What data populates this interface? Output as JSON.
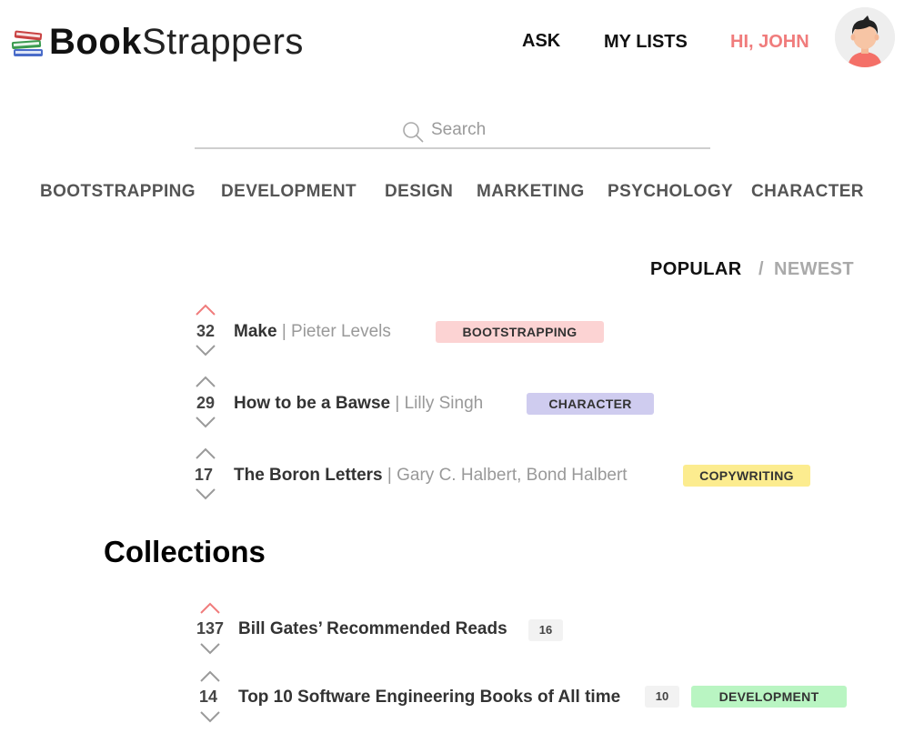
{
  "brand": {
    "name_bold": "Book",
    "name_light": "Strappers"
  },
  "nav": {
    "ask": "ASK",
    "my_lists": "MY LISTS",
    "greeting": "HI, JOHN"
  },
  "search": {
    "placeholder": "Search"
  },
  "categories": [
    "BOOTSTRAPPING",
    "DEVELOPMENT",
    "DESIGN",
    "MARKETING",
    "PSYCHOLOGY",
    "CHARACTER"
  ],
  "sort": {
    "popular": "POPULAR",
    "separator": "/",
    "newest": "NEWEST",
    "active": "popular"
  },
  "books": [
    {
      "votes": "32",
      "title": "Make",
      "author": "| Pieter Levels",
      "tag": "BOOTSTRAPPING",
      "tag_color": "#fcd3d3",
      "upvoted": true
    },
    {
      "votes": "29",
      "title": "How to be a Bawse",
      "author": "| Lilly Singh",
      "tag": "CHARACTER",
      "tag_color": "#cfccef",
      "upvoted": false
    },
    {
      "votes": "17",
      "title": "The Boron Letters",
      "author": "| Gary C. Halbert, Bond Halbert",
      "tag": "COPYWRITING",
      "tag_color": "#fcec8f",
      "upvoted": false
    }
  ],
  "collections_heading": "Collections",
  "collections": [
    {
      "votes": "137",
      "title": "Bill Gates’ Recommended Reads",
      "count": "16",
      "upvoted": true
    },
    {
      "votes": "14",
      "title": "Top 10 Software Engineering Books of All time",
      "count": "10",
      "tag": "DEVELOPMENT",
      "tag_color": "#b9f5c2",
      "upvoted": false
    }
  ],
  "colors": {
    "accent": "#f07c7c",
    "arrow_inactive": "#9a9a9a",
    "text_muted": "#999999"
  },
  "icons": {
    "logo": "books-stack-icon",
    "search": "magnifier-icon",
    "avatar": "user-avatar-icon",
    "upvote": "chevron-up-icon",
    "downvote": "chevron-down-icon"
  }
}
